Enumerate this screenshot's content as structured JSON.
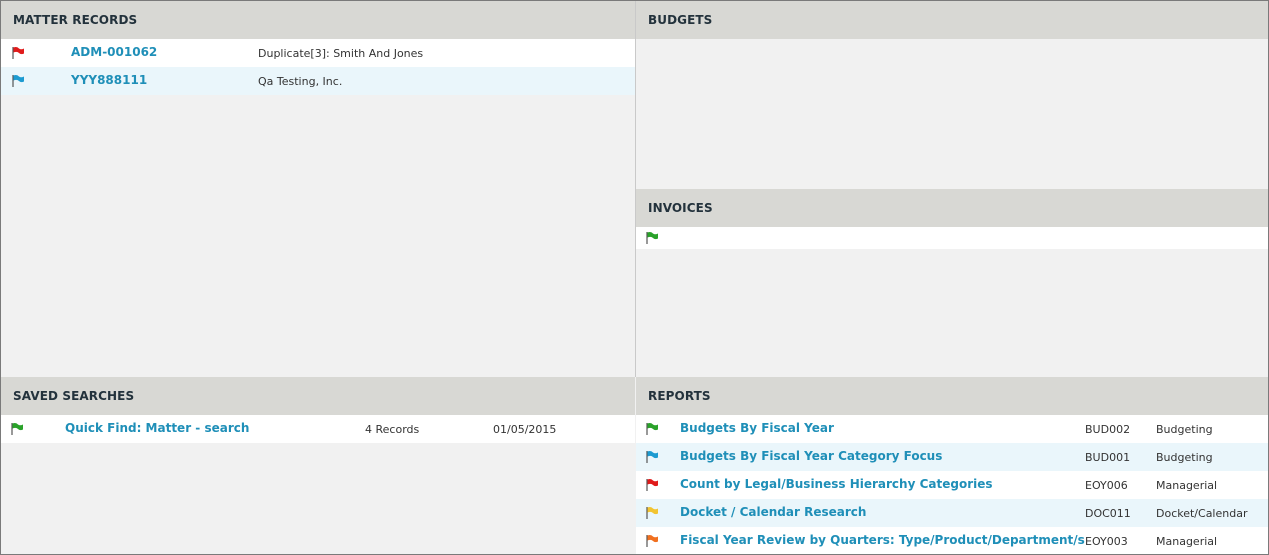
{
  "colors": {
    "header_bg": "#d8d8d4",
    "body_bg": "#f1f1f1",
    "link": "#1f8fb8",
    "row_alt": "#eaf6fb",
    "flag_red": "#e01b1b",
    "flag_blue": "#1d9bd1",
    "flag_green": "#2aa22a",
    "flag_yellow": "#f2c431",
    "flag_orange": "#f07020"
  },
  "matter_records": {
    "title": "MATTER RECORDS",
    "rows": [
      {
        "flag": "red",
        "id": "ADM-001062",
        "name": "Duplicate[3]: Smith And Jones"
      },
      {
        "flag": "blue",
        "id": "YYY888111",
        "name": "Qa Testing, Inc."
      }
    ]
  },
  "budgets": {
    "title": "BUDGETS"
  },
  "invoices": {
    "title": "INVOICES",
    "rows": [
      {
        "flag": "green"
      }
    ]
  },
  "saved_searches": {
    "title": "SAVED SEARCHES",
    "rows": [
      {
        "flag": "green",
        "name": "Quick Find: Matter - search",
        "records": "4 Records",
        "date": "01/05/2015"
      }
    ]
  },
  "reports": {
    "title": "REPORTS",
    "rows": [
      {
        "flag": "green",
        "name": "Budgets By Fiscal Year",
        "code": "BUD002",
        "category": "Budgeting"
      },
      {
        "flag": "blue",
        "name": "Budgets By Fiscal Year Category Focus",
        "code": "BUD001",
        "category": "Budgeting"
      },
      {
        "flag": "red",
        "name": "Count by Legal/Business Hierarchy Categories",
        "code": "EOY006",
        "category": "Managerial"
      },
      {
        "flag": "yellow",
        "name": "Docket / Calendar Research",
        "code": "DOC011",
        "category": "Docket/Calendar"
      },
      {
        "flag": "orange",
        "name": "Fiscal Year Review by Quarters: Type/Product/Department/s",
        "code": "EOY003",
        "category": "Managerial"
      }
    ]
  }
}
